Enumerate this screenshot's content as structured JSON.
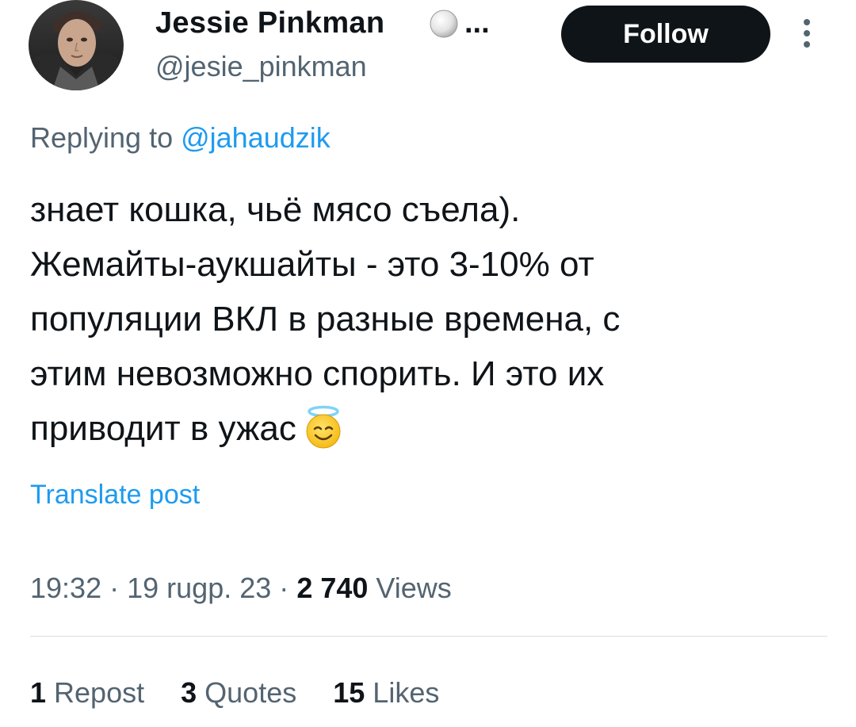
{
  "author": {
    "display_name": "Jessie Pinkman",
    "name_ellipsis": "...",
    "handle": "@jesie_pinkman",
    "avatar_icon": "profile-photo",
    "badge_icon": "white-ball-icon"
  },
  "follow_button": {
    "label": "Follow"
  },
  "more_button": {
    "icon": "vertical-ellipsis-icon"
  },
  "reply_context": {
    "prefix": "Replying to ",
    "mention": "@jahaudzik"
  },
  "tweet": {
    "lines": [
      "знает кошка, чьё мясо съела).",
      "Жемайты-аукшайты - это 3-10% от",
      "популяции ВКЛ в разные времена, с",
      "этим невозможно спорить. И это их",
      "приводит в ужас"
    ],
    "emoji_icon": "smiling-face-with-halo-icon"
  },
  "translate_link": "Translate post",
  "meta": {
    "time": "19:32",
    "separator": "·",
    "date": "19 rugp. 23",
    "views_count": "2 740",
    "views_label": "Views"
  },
  "stats": {
    "reposts": {
      "count": "1",
      "label": "Repost"
    },
    "quotes": {
      "count": "3",
      "label": "Quotes"
    },
    "likes": {
      "count": "15",
      "label": "Likes"
    }
  },
  "colors": {
    "text": "#0f1419",
    "secondary": "#536471",
    "link": "#1d9bf0",
    "button_bg": "#0f1419",
    "divider": "#d9dee2"
  }
}
